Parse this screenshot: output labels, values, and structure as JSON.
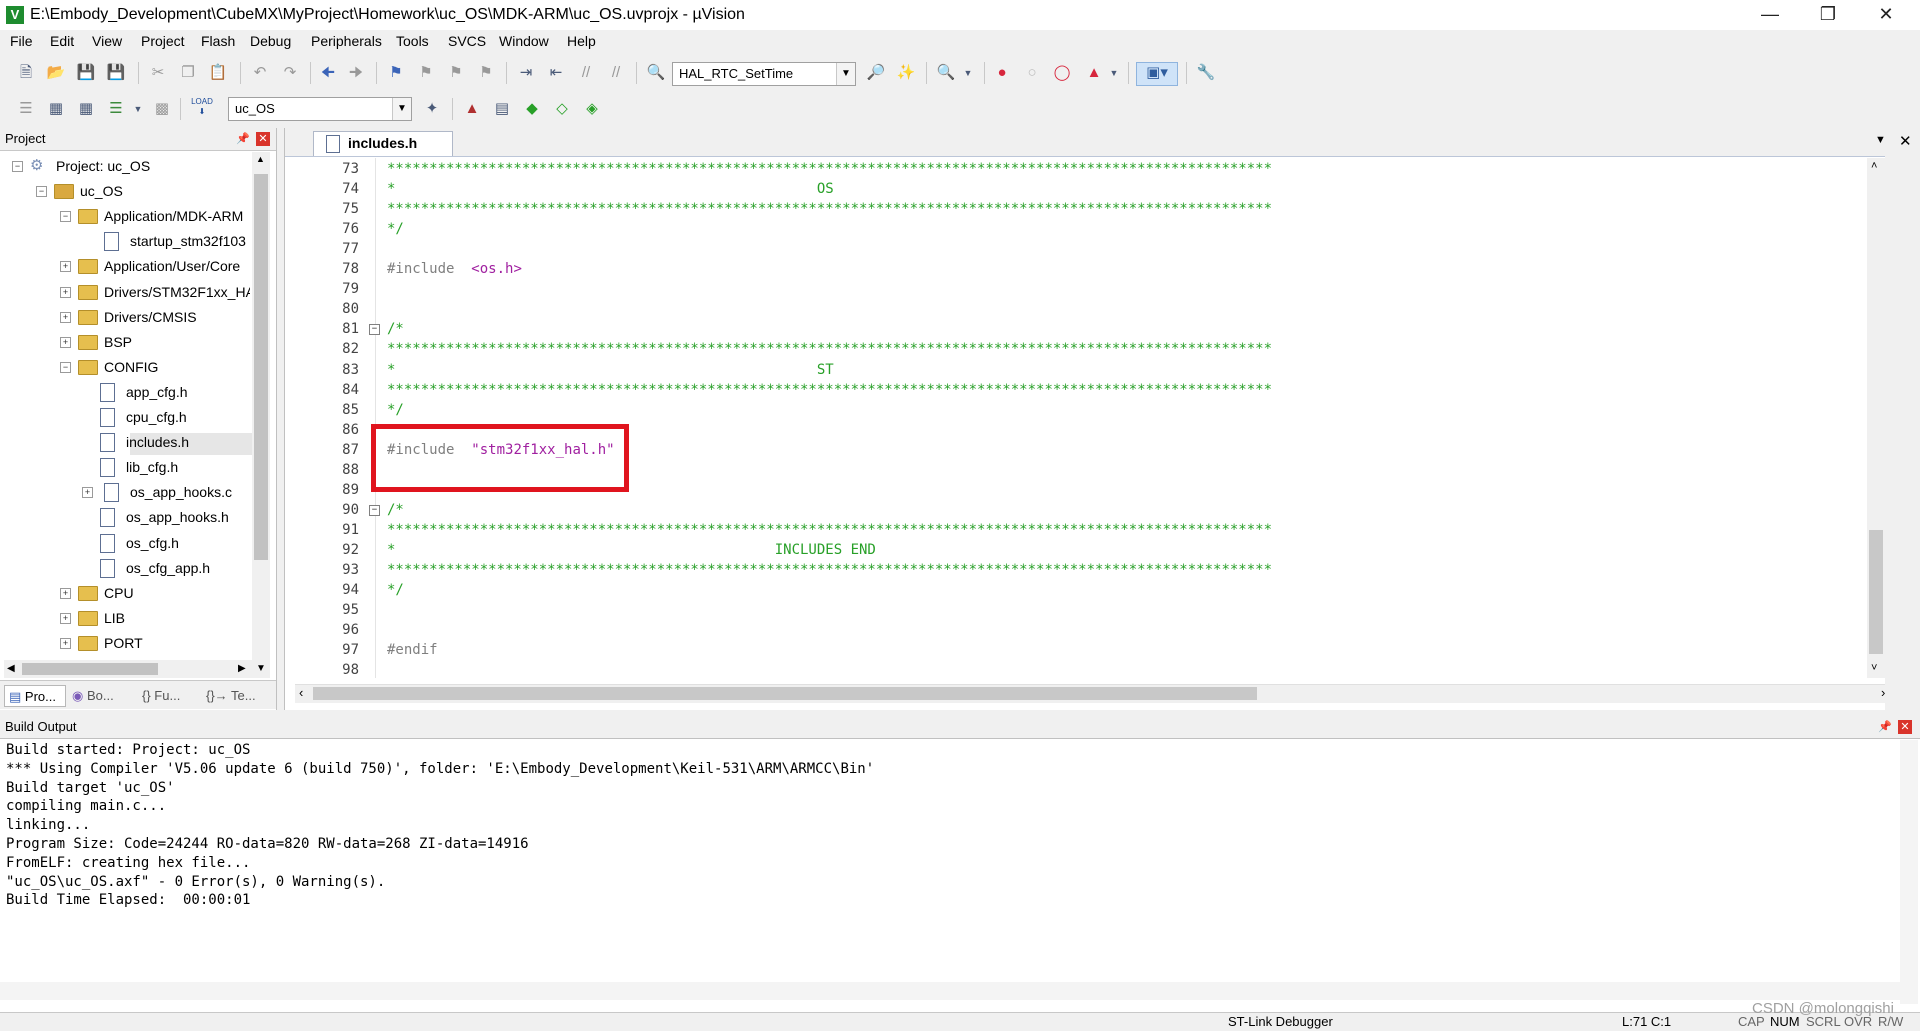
{
  "window": {
    "title": "E:\\Embody_Development\\CubeMX\\MyProject\\Homework\\uc_OS\\MDK-ARM\\uc_OS.uvprojx - µVision",
    "app_icon_glyph": "V"
  },
  "menu": [
    "File",
    "Edit",
    "View",
    "Project",
    "Flash",
    "Debug",
    "Peripherals",
    "Tools",
    "SVCS",
    "Window",
    "Help"
  ],
  "toolbar1": {
    "function_combo": "HAL_RTC_SetTime"
  },
  "toolbar2": {
    "target_combo": "uc_OS",
    "load_label": "LOAD"
  },
  "project_panel": {
    "title": "Project",
    "tree": [
      {
        "label": "Project: uc_OS",
        "kind": "project",
        "expander": "-"
      },
      {
        "label": "uc_OS",
        "kind": "target",
        "expander": "-"
      },
      {
        "label": "Application/MDK-ARM",
        "kind": "folder",
        "expander": "-"
      },
      {
        "label": "startup_stm32f103",
        "kind": "file",
        "expander": ""
      },
      {
        "label": "Application/User/Core",
        "kind": "folder",
        "expander": "+"
      },
      {
        "label": "Drivers/STM32F1xx_HA",
        "kind": "folder",
        "expander": "+"
      },
      {
        "label": "Drivers/CMSIS",
        "kind": "folder",
        "expander": "+"
      },
      {
        "label": "BSP",
        "kind": "folder",
        "expander": "+"
      },
      {
        "label": "CONFIG",
        "kind": "folder",
        "expander": "-"
      },
      {
        "label": "app_cfg.h",
        "kind": "file",
        "expander": ""
      },
      {
        "label": "cpu_cfg.h",
        "kind": "file",
        "expander": ""
      },
      {
        "label": "includes.h",
        "kind": "file",
        "expander": ""
      },
      {
        "label": "lib_cfg.h",
        "kind": "file",
        "expander": ""
      },
      {
        "label": "os_app_hooks.c",
        "kind": "file",
        "expander": "+"
      },
      {
        "label": "os_app_hooks.h",
        "kind": "file",
        "expander": ""
      },
      {
        "label": "os_cfg.h",
        "kind": "file",
        "expander": ""
      },
      {
        "label": "os_cfg_app.h",
        "kind": "file",
        "expander": ""
      },
      {
        "label": "CPU",
        "kind": "folder",
        "expander": "+"
      },
      {
        "label": "LIB",
        "kind": "folder",
        "expander": "+"
      },
      {
        "label": "PORT",
        "kind": "folder",
        "expander": "+"
      }
    ],
    "tabs": [
      "Pro...",
      "Bo...",
      "{} Fu...",
      "{}→ Te..."
    ]
  },
  "editor": {
    "tab": "includes.h",
    "lines": [
      {
        "n": "73",
        "segs": [
          {
            "c": "cmt",
            "t": "*********************************************************************************************************"
          }
        ]
      },
      {
        "n": "74",
        "segs": [
          {
            "c": "cmt",
            "t": "*                                                  OS"
          }
        ]
      },
      {
        "n": "75",
        "segs": [
          {
            "c": "cmt",
            "t": "*********************************************************************************************************"
          }
        ]
      },
      {
        "n": "76",
        "segs": [
          {
            "c": "cmt",
            "t": "*/"
          }
        ]
      },
      {
        "n": "77",
        "segs": []
      },
      {
        "n": "78",
        "segs": [
          {
            "c": "kw",
            "t": "#include  "
          },
          {
            "c": "str",
            "t": "<os.h>"
          }
        ]
      },
      {
        "n": "79",
        "segs": []
      },
      {
        "n": "80",
        "segs": []
      },
      {
        "n": "81",
        "segs": [
          {
            "c": "cmt",
            "t": "/*"
          }
        ],
        "fold": true
      },
      {
        "n": "82",
        "segs": [
          {
            "c": "cmt",
            "t": "*********************************************************************************************************"
          }
        ]
      },
      {
        "n": "83",
        "segs": [
          {
            "c": "cmt",
            "t": "*                                                  ST"
          }
        ]
      },
      {
        "n": "84",
        "segs": [
          {
            "c": "cmt",
            "t": "*********************************************************************************************************"
          }
        ]
      },
      {
        "n": "85",
        "segs": [
          {
            "c": "cmt",
            "t": "*/"
          }
        ]
      },
      {
        "n": "86",
        "segs": []
      },
      {
        "n": "87",
        "segs": [
          {
            "c": "kw",
            "t": "#include  "
          },
          {
            "c": "str",
            "t": "\"stm32f1xx_hal.h\""
          }
        ]
      },
      {
        "n": "88",
        "segs": []
      },
      {
        "n": "89",
        "segs": []
      },
      {
        "n": "90",
        "segs": [
          {
            "c": "cmt",
            "t": "/*"
          }
        ],
        "fold": true
      },
      {
        "n": "91",
        "segs": [
          {
            "c": "cmt",
            "t": "*********************************************************************************************************"
          }
        ]
      },
      {
        "n": "92",
        "segs": [
          {
            "c": "cmt",
            "t": "*                                             INCLUDES END"
          }
        ]
      },
      {
        "n": "93",
        "segs": [
          {
            "c": "cmt",
            "t": "*********************************************************************************************************"
          }
        ]
      },
      {
        "n": "94",
        "segs": [
          {
            "c": "cmt",
            "t": "*/"
          }
        ]
      },
      {
        "n": "95",
        "segs": []
      },
      {
        "n": "96",
        "segs": []
      },
      {
        "n": "97",
        "segs": [
          {
            "c": "kw",
            "t": "#endif"
          }
        ]
      },
      {
        "n": "98",
        "segs": []
      }
    ]
  },
  "build_output": {
    "title": "Build Output",
    "lines": [
      "Build started: Project: uc_OS",
      "*** Using Compiler 'V5.06 update 6 (build 750)', folder: 'E:\\Embody_Development\\Keil-531\\ARM\\ARMCC\\Bin'",
      "Build target 'uc_OS'",
      "compiling main.c...",
      "linking...",
      "Program Size: Code=24244 RO-data=820 RW-data=268 ZI-data=14916",
      "FromELF: creating hex file...",
      "\"uc_OS\\uc_OS.axf\" - 0 Error(s), 0 Warning(s).",
      "Build Time Elapsed:  00:00:01"
    ]
  },
  "status": {
    "debugger": "ST-Link Debugger",
    "position": "L:71 C:1",
    "cap": "CAP",
    "num": "NUM",
    "scrl": "SCRL",
    "ovr": "OVR",
    "rw": "R/W"
  },
  "watermark": "CSDN @molongqishi"
}
